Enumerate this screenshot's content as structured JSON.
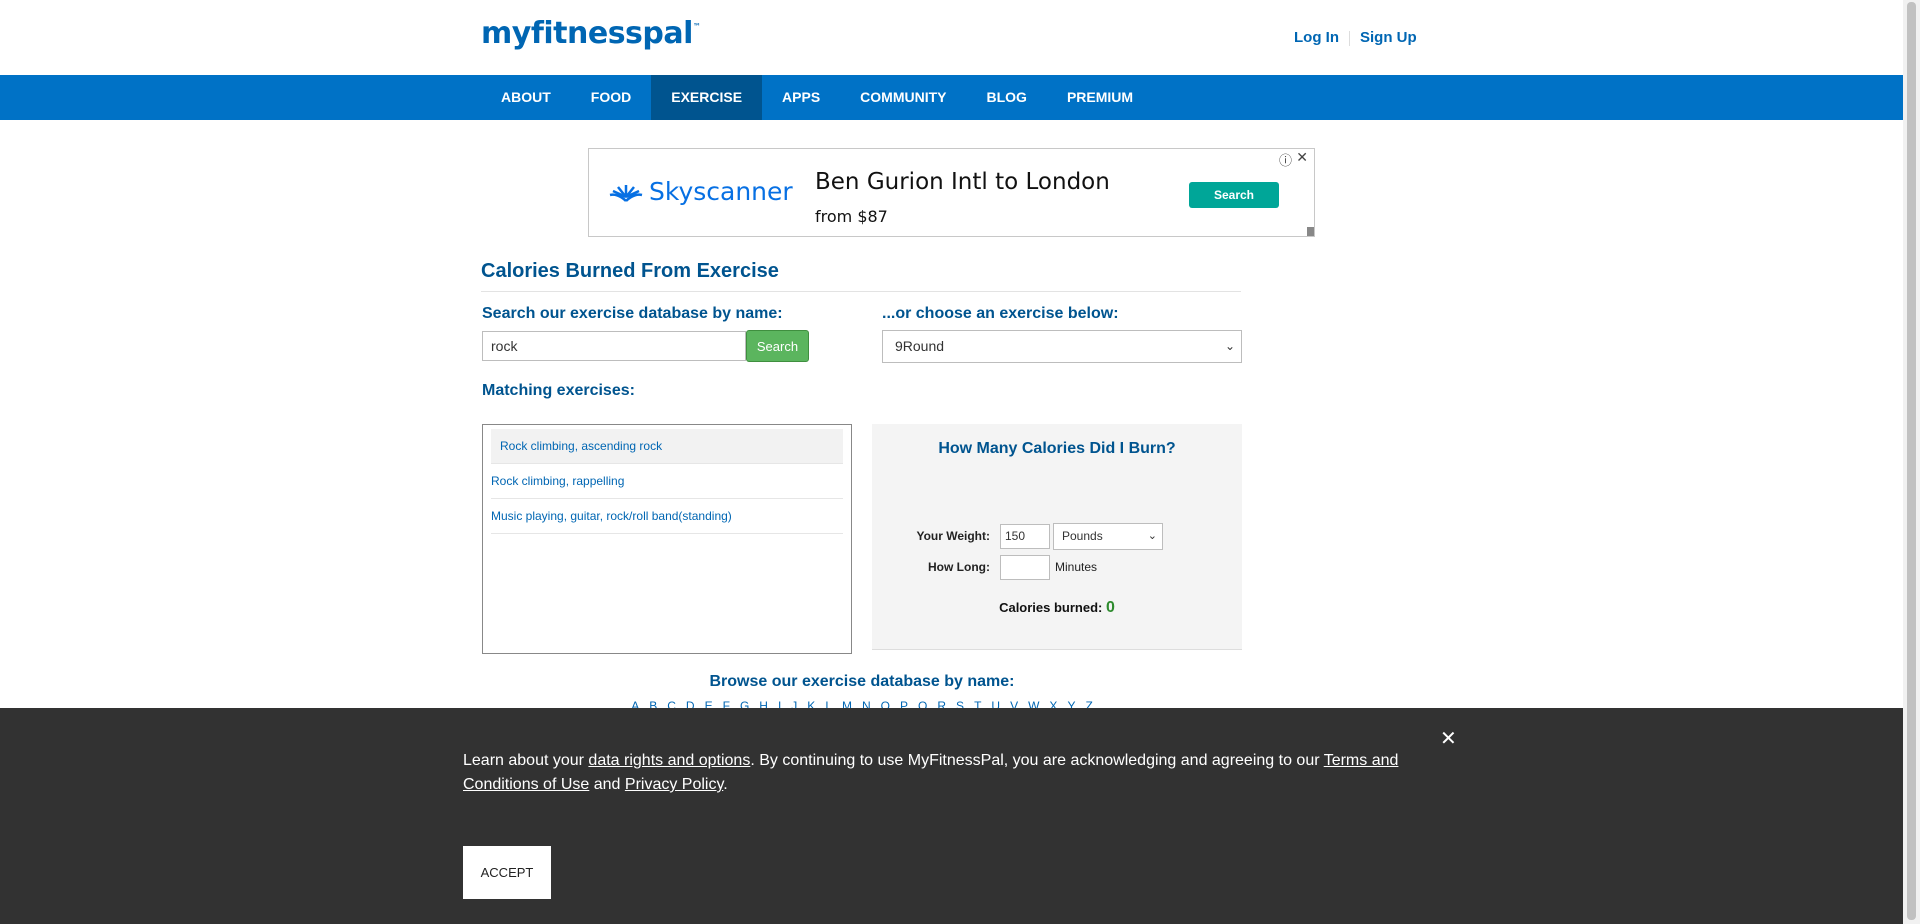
{
  "header": {
    "logo": "myfitnesspal",
    "logo_mark": "™",
    "login": "Log In",
    "signup": "Sign Up"
  },
  "nav": {
    "items": [
      "ABOUT",
      "FOOD",
      "EXERCISE",
      "APPS",
      "COMMUNITY",
      "BLOG",
      "PREMIUM"
    ],
    "active": "EXERCISE"
  },
  "ad": {
    "brand": "Skyscanner",
    "title": "Ben Gurion Intl to London",
    "price": "from $87",
    "button": "Search",
    "info_icon": "info-icon",
    "close_icon": "close-icon"
  },
  "main": {
    "title": "Calories Burned From Exercise",
    "search_label": "Search our exercise database by name:",
    "search_value": "rock",
    "search_button": "Search",
    "choose_label": "...or choose an exercise below:",
    "choose_value": "9Round",
    "matching_label": "Matching exercises:",
    "matches": [
      "Rock climbing, ascending rock",
      "Rock climbing, rappelling",
      "Music playing, guitar, rock/roll band(standing)"
    ],
    "calc": {
      "title": "How Many Calories Did I Burn?",
      "weight_label": "Your Weight:",
      "weight_value": "150",
      "weight_unit": "Pounds",
      "long_label": "How Long:",
      "long_value": "",
      "minutes": "Minutes",
      "burned_label": "Calories burned:",
      "burned_value": "0"
    },
    "browse_label": "Browse our exercise database by name:",
    "alphabet": [
      "A",
      "B",
      "C",
      "D",
      "E",
      "F",
      "G",
      "H",
      "I",
      "J",
      "K",
      "L",
      "M",
      "N",
      "O",
      "P",
      "Q",
      "R",
      "S",
      "T",
      "U",
      "V",
      "W",
      "X",
      "Y",
      "Z"
    ]
  },
  "cookie": {
    "t1": "Learn about your ",
    "link_rights": "data rights and options",
    "t2": ". By continuing to use MyFitnessPal, you are acknowledging and agreeing to our ",
    "link_terms": "Terms and Conditions of Use",
    "t3": " and ",
    "link_privacy": "Privacy Policy",
    "t4": ".",
    "accept": "ACCEPT",
    "close_icon": "close-icon"
  },
  "colors": {
    "brand_blue": "#0066B3",
    "nav_blue": "#0072C6",
    "nav_active": "#00548F",
    "search_green": "#5BB55E",
    "cookie_bg": "#323232"
  }
}
